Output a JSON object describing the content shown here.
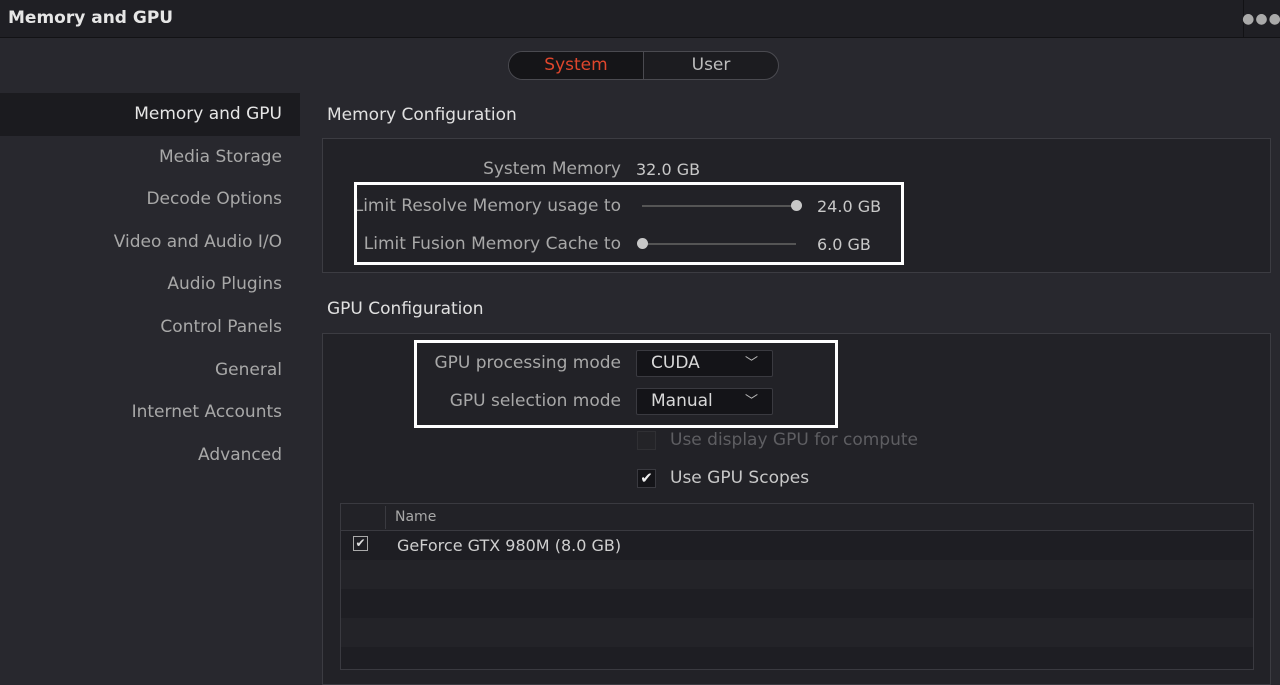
{
  "window": {
    "title": "Memory and GPU",
    "more_icon": "more-icon"
  },
  "tabs": [
    {
      "label": "System",
      "selected": true
    },
    {
      "label": "User",
      "selected": false
    }
  ],
  "sidebar": {
    "items": [
      {
        "label": "Memory and GPU",
        "active": true
      },
      {
        "label": "Media Storage"
      },
      {
        "label": "Decode Options"
      },
      {
        "label": "Video and Audio I/O"
      },
      {
        "label": "Audio Plugins"
      },
      {
        "label": "Control Panels"
      },
      {
        "label": "General"
      },
      {
        "label": "Internet Accounts"
      },
      {
        "label": "Advanced"
      }
    ]
  },
  "memory": {
    "section_title": "Memory Configuration",
    "system_memory_label": "System Memory",
    "system_memory_value": "32.0 GB",
    "resolve_limit_label": "Limit Resolve Memory usage to",
    "resolve_limit_value": "24.0 GB",
    "resolve_limit_fraction": 1.0,
    "fusion_cache_label": "Limit Fusion Memory Cache to",
    "fusion_cache_value": "6.0 GB",
    "fusion_cache_fraction": 0.0
  },
  "gpu": {
    "section_title": "GPU Configuration",
    "processing_mode_label": "GPU processing mode",
    "processing_mode_value": "CUDA",
    "selection_mode_label": "GPU selection mode",
    "selection_mode_value": "Manual",
    "display_gpu_label": "Use display GPU for compute",
    "display_gpu_checked": false,
    "display_gpu_enabled": false,
    "scopes_label": "Use GPU Scopes",
    "scopes_checked": true,
    "table": {
      "header_name": "Name",
      "rows": [
        {
          "name": "GeForce GTX 980M (8.0 GB)",
          "checked": true
        }
      ]
    }
  },
  "colors": {
    "accent": "#e0462c",
    "background": "#28282e",
    "highlight_box": "#ffffff"
  }
}
